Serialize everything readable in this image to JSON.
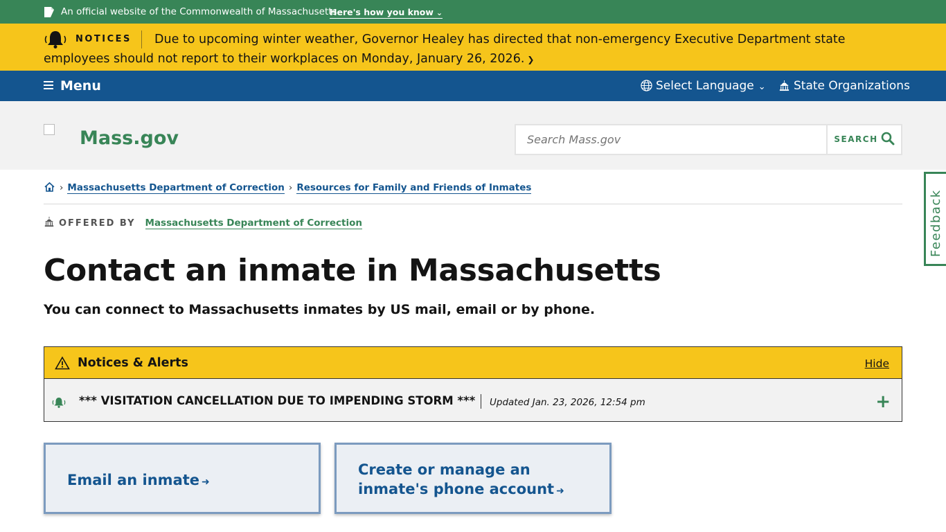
{
  "official_banner": {
    "text": "An official website of the Commonwealth of Massachusetts",
    "link": "Here's how you know"
  },
  "notices_banner": {
    "label": "NOTICES",
    "message": "Due to upcoming winter weather, Governor Healey has directed that non-emergency Executive Department state employees should not report to their workplaces on Monday, January 26, 2026."
  },
  "topnav": {
    "menu": "Menu",
    "language": "Select Language",
    "organizations": "State Organizations"
  },
  "header": {
    "logo_text": "Mass.gov",
    "search_placeholder": "Search Mass.gov",
    "search_button": "SEARCH"
  },
  "breadcrumb": {
    "items": [
      "Massachusetts Department of Correction",
      "Resources for Family and Friends of Inmates"
    ]
  },
  "offered_by": {
    "label": "OFFERED BY",
    "org": "Massachusetts Department of Correction"
  },
  "page": {
    "title": "Contact an inmate in Massachusetts",
    "lede": "You can connect to Massachusetts inmates by US mail, email or by phone."
  },
  "alerts": {
    "heading": "Notices & Alerts",
    "hide": "Hide",
    "items": [
      {
        "title": "*** VISITATION CANCELLATION DUE TO IMPENDING STORM ***",
        "updated": "Updated Jan. 23, 2026, 12:54 pm"
      }
    ]
  },
  "actions": {
    "email": "Email an inmate",
    "phone_line1": "Create or manage an",
    "phone_line2": "inmate's phone account"
  },
  "feedback": "Feedback",
  "colors": {
    "green": "#388557",
    "yellow": "#f6c51b",
    "blue": "#14558f"
  }
}
